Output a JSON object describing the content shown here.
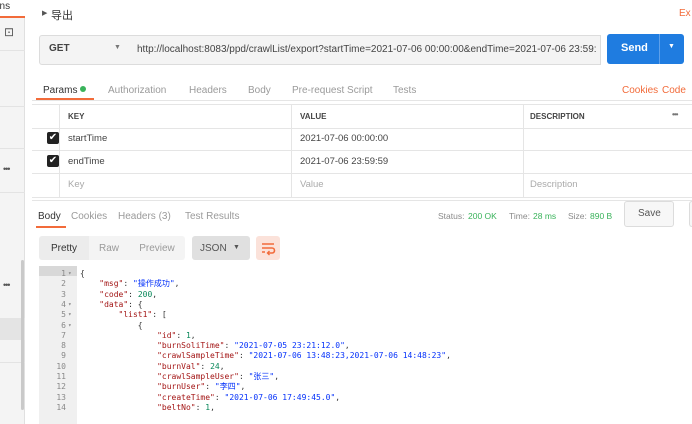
{
  "sidebar": {
    "tab_label": "ons",
    "dots_1": "•••",
    "dots_2": "•••"
  },
  "request": {
    "title": "导出",
    "export_link": "Ex",
    "method": "GET",
    "url": "http://localhost:8083/ppd/crawlList/export?startTime=2021-07-06 00:00:00&endTime=2021-07-06 23:59:...",
    "send_label": "Send"
  },
  "request_tabs": {
    "params": "Params",
    "authorization": "Authorization",
    "headers": "Headers",
    "body": "Body",
    "pre_request": "Pre-request Script",
    "tests": "Tests",
    "cookies": "Cookies",
    "code": "Code"
  },
  "params_table": {
    "headers": {
      "key": "KEY",
      "value": "VALUE",
      "description": "DESCRIPTION",
      "more": "•••"
    },
    "rows": [
      {
        "key": "startTime",
        "value": "2021-07-06 00:00:00",
        "description": "",
        "checked": true
      },
      {
        "key": "endTime",
        "value": "2021-07-06 23:59:59",
        "description": "",
        "checked": true
      }
    ],
    "placeholder": {
      "key": "Key",
      "value": "Value",
      "description": "Description"
    }
  },
  "response_tabs": {
    "body": "Body",
    "cookies": "Cookies",
    "headers": "Headers (3)",
    "test_results": "Test Results",
    "status_label": "Status:",
    "status_value": "200 OK",
    "time_label": "Time:",
    "time_value": "28 ms",
    "size_label": "Size:",
    "size_value": "890 B",
    "save_label": "Save"
  },
  "format_bar": {
    "pretty": "Pretty",
    "raw": "Raw",
    "preview": "Preview",
    "format": "JSON"
  },
  "code_lines": [
    {
      "n": "1",
      "fold": "▾",
      "indent": "",
      "parts": [
        [
          "p",
          "{"
        ]
      ]
    },
    {
      "n": "2",
      "fold": "",
      "indent": "    ",
      "parts": [
        [
          "k",
          "\"msg\""
        ],
        [
          "p",
          ": "
        ],
        [
          "s",
          "\"操作成功\""
        ],
        [
          "p",
          ","
        ]
      ]
    },
    {
      "n": "3",
      "fold": "",
      "indent": "    ",
      "parts": [
        [
          "k",
          "\"code\""
        ],
        [
          "p",
          ": "
        ],
        [
          "n",
          "200"
        ],
        [
          "p",
          ","
        ]
      ]
    },
    {
      "n": "4",
      "fold": "▾",
      "indent": "    ",
      "parts": [
        [
          "k",
          "\"data\""
        ],
        [
          "p",
          ": {"
        ]
      ]
    },
    {
      "n": "5",
      "fold": "▾",
      "indent": "        ",
      "parts": [
        [
          "k",
          "\"list1\""
        ],
        [
          "p",
          ": ["
        ]
      ]
    },
    {
      "n": "6",
      "fold": "▾",
      "indent": "            ",
      "parts": [
        [
          "p",
          "{"
        ]
      ]
    },
    {
      "n": "7",
      "fold": "",
      "indent": "                ",
      "parts": [
        [
          "k",
          "\"id\""
        ],
        [
          "p",
          ": "
        ],
        [
          "n",
          "1"
        ],
        [
          "p",
          ","
        ]
      ]
    },
    {
      "n": "8",
      "fold": "",
      "indent": "                ",
      "parts": [
        [
          "k",
          "\"burnSoliTime\""
        ],
        [
          "p",
          ": "
        ],
        [
          "s",
          "\"2021-07-05 23:21:12.0\""
        ],
        [
          "p",
          ","
        ]
      ]
    },
    {
      "n": "9",
      "fold": "",
      "indent": "                ",
      "parts": [
        [
          "k",
          "\"crawlSampleTime\""
        ],
        [
          "p",
          ": "
        ],
        [
          "s",
          "\"2021-07-06 13:48:23,2021-07-06 14:48:23\""
        ],
        [
          "p",
          ","
        ]
      ]
    },
    {
      "n": "10",
      "fold": "",
      "indent": "                ",
      "parts": [
        [
          "k",
          "\"burnVal\""
        ],
        [
          "p",
          ": "
        ],
        [
          "n",
          "24"
        ],
        [
          "p",
          ","
        ]
      ]
    },
    {
      "n": "11",
      "fold": "",
      "indent": "                ",
      "parts": [
        [
          "k",
          "\"crawlSampleUser\""
        ],
        [
          "p",
          ": "
        ],
        [
          "s",
          "\"张三\""
        ],
        [
          "p",
          ","
        ]
      ]
    },
    {
      "n": "12",
      "fold": "",
      "indent": "                ",
      "parts": [
        [
          "k",
          "\"burnUser\""
        ],
        [
          "p",
          ": "
        ],
        [
          "s",
          "\"李四\""
        ],
        [
          "p",
          ","
        ]
      ]
    },
    {
      "n": "13",
      "fold": "",
      "indent": "                ",
      "parts": [
        [
          "k",
          "\"createTime\""
        ],
        [
          "p",
          ": "
        ],
        [
          "s",
          "\"2021-07-06 17:49:45.0\""
        ],
        [
          "p",
          ","
        ]
      ]
    },
    {
      "n": "14",
      "fold": "",
      "indent": "                ",
      "parts": [
        [
          "k",
          "\"beltNo\""
        ],
        [
          "p",
          ": "
        ],
        [
          "n",
          "1"
        ],
        [
          "p",
          ","
        ]
      ]
    }
  ]
}
